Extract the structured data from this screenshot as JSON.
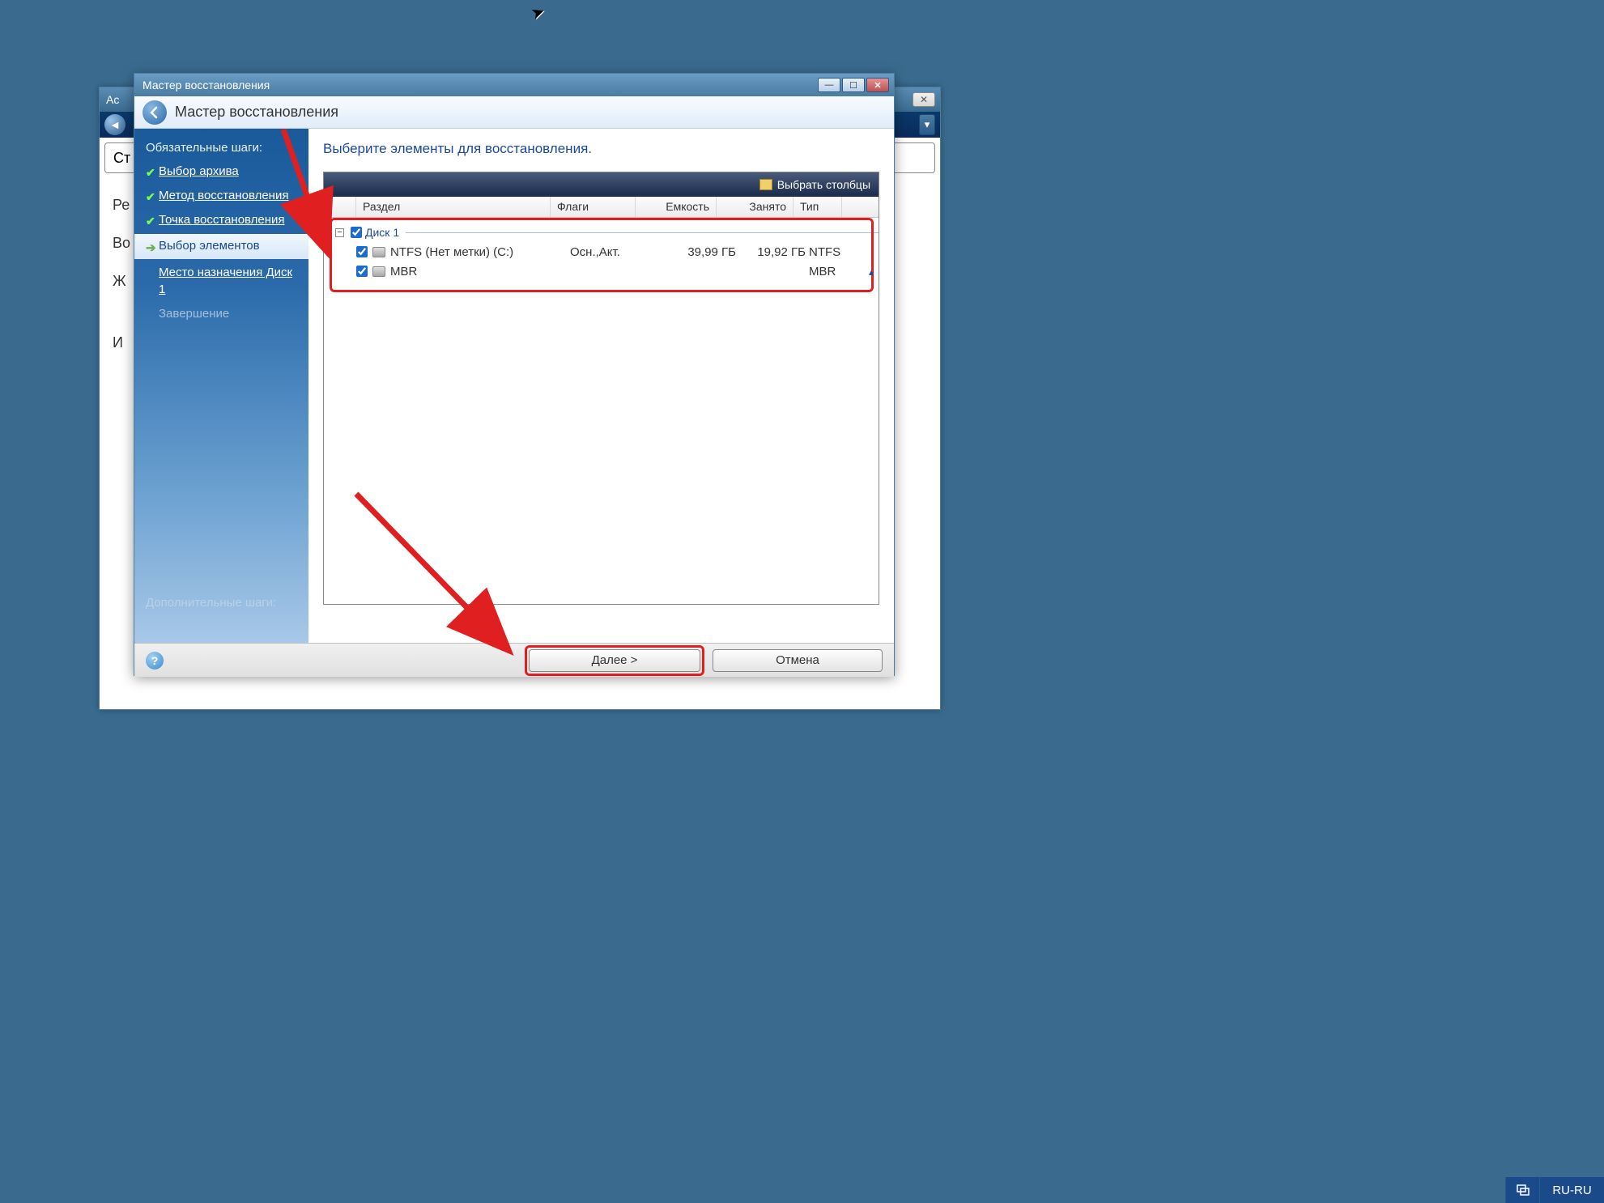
{
  "bg_window": {
    "title_fragment": "Ac",
    "tab_fragments": [
      "Ст",
      "Ре",
      "Во",
      "Ж",
      "И"
    ]
  },
  "wizard": {
    "titlebar": "Мастер восстановления",
    "header": "Мастер восстановления",
    "sidebar": {
      "heading": "Обязательные шаги:",
      "steps": {
        "archive": "Выбор архива",
        "method": "Метод восстановления",
        "point": "Точка восстановления",
        "elements": "Выбор элементов",
        "dest": "Место назначения Диск 1",
        "finish": "Завершение"
      },
      "optional": "Дополнительные шаги:"
    },
    "main": {
      "title": "Выберите элементы для восстановления.",
      "choose_columns": "Выбрать столбцы",
      "columns": {
        "partition": "Раздел",
        "flags": "Флаги",
        "capacity": "Емкость",
        "used": "Занято",
        "type": "Тип"
      },
      "group": "Диск 1",
      "rows": [
        {
          "name": "NTFS (Нет метки) (C:)",
          "flags": "Осн.,Акт.",
          "capacity": "39,99 ГБ",
          "used": "19,92 ГБ",
          "type": "NTFS"
        },
        {
          "name": "MBR",
          "flags": "",
          "capacity": "",
          "used": "",
          "type": "MBR"
        }
      ]
    },
    "footer": {
      "next": "Далее >",
      "cancel": "Отмена"
    }
  },
  "taskbar": {
    "lang": "RU-RU"
  }
}
